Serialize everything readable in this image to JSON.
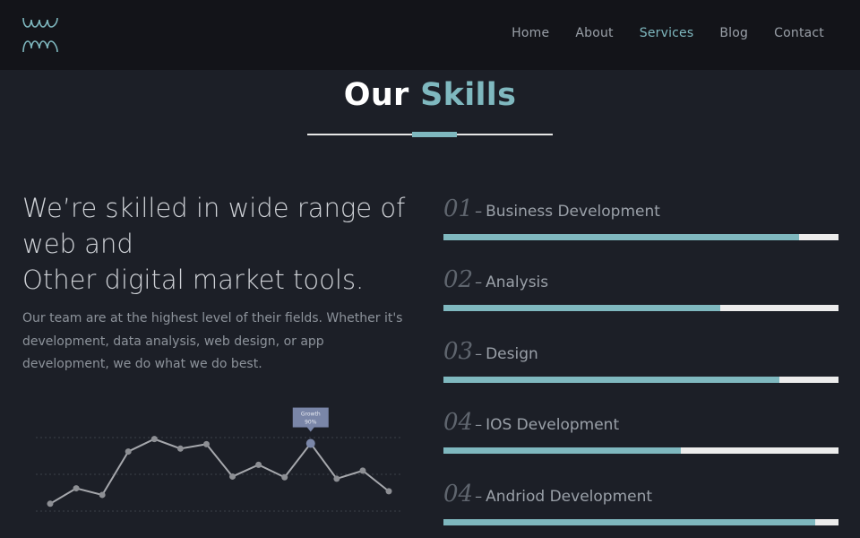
{
  "header": {
    "logo_icon": "spiral-loops-logo",
    "nav": [
      {
        "label": "Home",
        "active": false
      },
      {
        "label": "About",
        "active": false
      },
      {
        "label": "Services",
        "active": true
      },
      {
        "label": "Blog",
        "active": false
      },
      {
        "label": "Contact",
        "active": false
      }
    ]
  },
  "section": {
    "title_part1": "Our",
    "title_part2": "Skills"
  },
  "intro": {
    "heading_line1": "We’re skilled in wide range of web and",
    "heading_line2": "Other digital market tools.",
    "body": "Our team are at the highest level of their fields. Whether it's development, data analysis, web design, or app development, we do what we do best."
  },
  "skills": [
    {
      "number": "01",
      "name": "Business Development",
      "level": 0.9
    },
    {
      "number": "02",
      "name": "Analysis",
      "level": 0.7
    },
    {
      "number": "03",
      "name": "Design",
      "level": 0.85
    },
    {
      "number": "04",
      "name": "IOS Development",
      "level": 0.6
    },
    {
      "number": "04",
      "name": "Andriod Development",
      "level": 0.94
    }
  ],
  "chart_data": {
    "type": "line",
    "values": [
      1,
      3.1,
      2.2,
      8.1,
      9.8,
      8.5,
      9.1,
      4.7,
      6.3,
      4.6,
      9.2,
      4.4,
      5.5,
      2.7
    ],
    "tooltip": {
      "index": 10,
      "line1": "Growth",
      "line2": "90%"
    },
    "grid": true,
    "colors": {
      "line": "#a6a8ad",
      "point": "#8d8f94",
      "highlight": "#7a86a8"
    }
  },
  "colors": {
    "accent": "#7fb8bf",
    "background": "#1c1f27",
    "header": "#131419"
  }
}
